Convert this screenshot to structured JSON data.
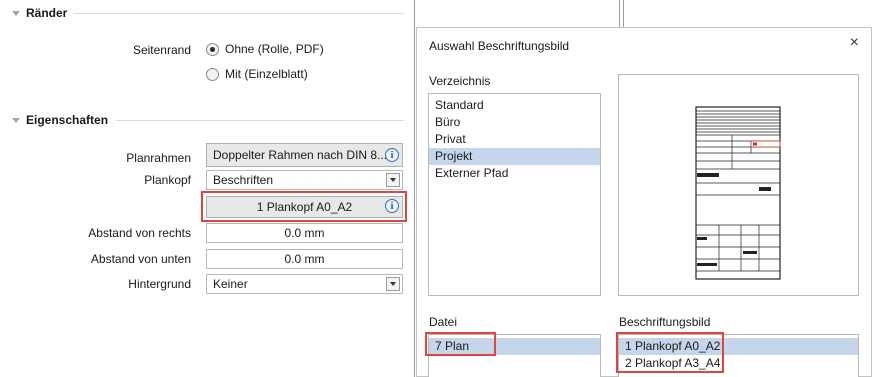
{
  "raender": {
    "heading": "Ränder",
    "seitenrand_label": "Seitenrand",
    "options": [
      {
        "label": "Ohne (Rolle, PDF)",
        "selected": true
      },
      {
        "label": "Mit (Einzelblatt)",
        "selected": false
      }
    ]
  },
  "eigenschaften": {
    "heading": "Eigenschaften",
    "planrahmen": {
      "label": "Planrahmen",
      "value": "Doppelter Rahmen nach DIN 8..."
    },
    "plankopf": {
      "label": "Plankopf",
      "value": "Beschriften"
    },
    "plankopf_selection": {
      "value": "1 Plankopf A0_A2"
    },
    "abstand_rechts": {
      "label": "Abstand von rechts",
      "value": "0.0 mm"
    },
    "abstand_unten": {
      "label": "Abstand von unten",
      "value": "0.0 mm"
    },
    "hintergrund": {
      "label": "Hintergrund",
      "value": "Keiner"
    }
  },
  "dialog": {
    "title": "Auswahl Beschriftungsbild",
    "close": "×",
    "verzeichnis_label": "Verzeichnis",
    "verzeichnis_items": [
      {
        "label": "Standard",
        "selected": false
      },
      {
        "label": "Büro",
        "selected": false
      },
      {
        "label": "Privat",
        "selected": false
      },
      {
        "label": "Projekt",
        "selected": true
      },
      {
        "label": "Externer Pfad",
        "selected": false
      }
    ],
    "datei_label": "Datei",
    "datei_items": [
      {
        "label": "7 Plan",
        "selected": true
      }
    ],
    "beschriftungsbild_label": "Beschriftungsbild",
    "beschriftungsbild_items": [
      {
        "label": "1 Plankopf A0_A2",
        "selected": true
      },
      {
        "label": "2 Plankopf A3_A4",
        "selected": false
      }
    ]
  },
  "icons": {
    "info": "i",
    "dropdown": "chevron-down-icon"
  },
  "colors": {
    "highlight_border": "#e0443c",
    "selection": "#c5d6ec"
  }
}
